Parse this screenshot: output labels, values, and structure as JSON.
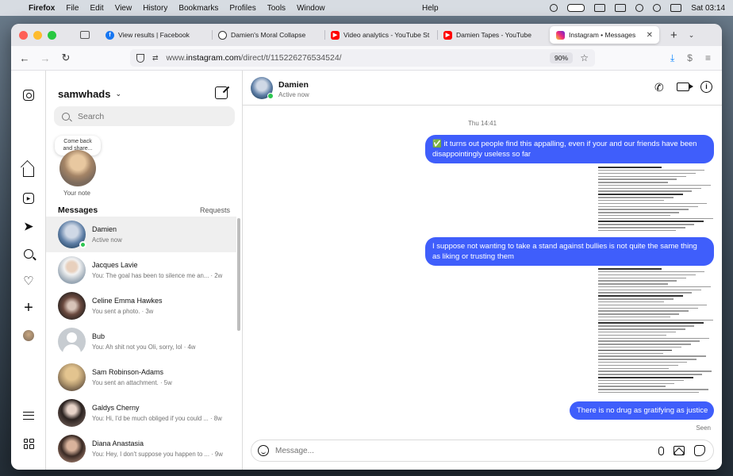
{
  "menubar": {
    "app": "Firefox",
    "items": [
      "File",
      "Edit",
      "View",
      "History",
      "Bookmarks",
      "Profiles",
      "Tools",
      "Window"
    ],
    "help": "Help",
    "clock": "Sat 03:14"
  },
  "tabs": [
    {
      "title": "View results | Facebook",
      "icon": "facebook-icon"
    },
    {
      "title": "Damien's Moral Collapse",
      "icon": "chatgpt-icon"
    },
    {
      "title": "Video analytics - YouTube St",
      "icon": "youtube-icon"
    },
    {
      "title": "Damien Tapes - YouTube",
      "icon": "youtube-icon"
    },
    {
      "title": "Instagram • Messages",
      "icon": "instagram-icon",
      "active": true
    }
  ],
  "urlbar": {
    "url_prefix": "www.",
    "url_domain": "instagram.com",
    "url_path": "/direct/t/115226276534524/",
    "zoom": "90%"
  },
  "inbox": {
    "username": "samwhads",
    "search_placeholder": "Search",
    "note_text": "Come back and share...",
    "note_label": "Your note",
    "messages_heading": "Messages",
    "requests_label": "Requests",
    "conversations": [
      {
        "name": "Damien",
        "preview": "Active now",
        "online": true
      },
      {
        "name": "Jacques Lavie",
        "preview": "You: The goal has been to silence me an... · 2w"
      },
      {
        "name": "Celine Emma Hawkes",
        "preview": "You sent a photo. · 3w"
      },
      {
        "name": "Bub",
        "preview": "You: Ah shit not you Oli, sorry, lol · 4w"
      },
      {
        "name": "Sam Robinson-Adams",
        "preview": "You sent an attachment. · 5w"
      },
      {
        "name": "Galdys Cherny",
        "preview": "You: Hi, I'd be much obliged if you could ... · 8w"
      },
      {
        "name": "Diana Anastasia",
        "preview": "You: Hey, I don't suppose you happen to ... · 9w"
      }
    ]
  },
  "chat": {
    "name": "Damien",
    "status": "Active now",
    "timestamp": "Thu 14:41",
    "messages": [
      "✅ it turns out people find this appalling, even if your and our friends have been disappointingly useless so far",
      "I suppose not wanting to take a stand against bullies is not quite the same thing as liking or trusting them",
      "There is no drug as gratifying as justice"
    ],
    "seen": "Seen",
    "composer_placeholder": "Message..."
  },
  "colors": {
    "bubble": "#3f5efb",
    "online": "#2dc651"
  }
}
